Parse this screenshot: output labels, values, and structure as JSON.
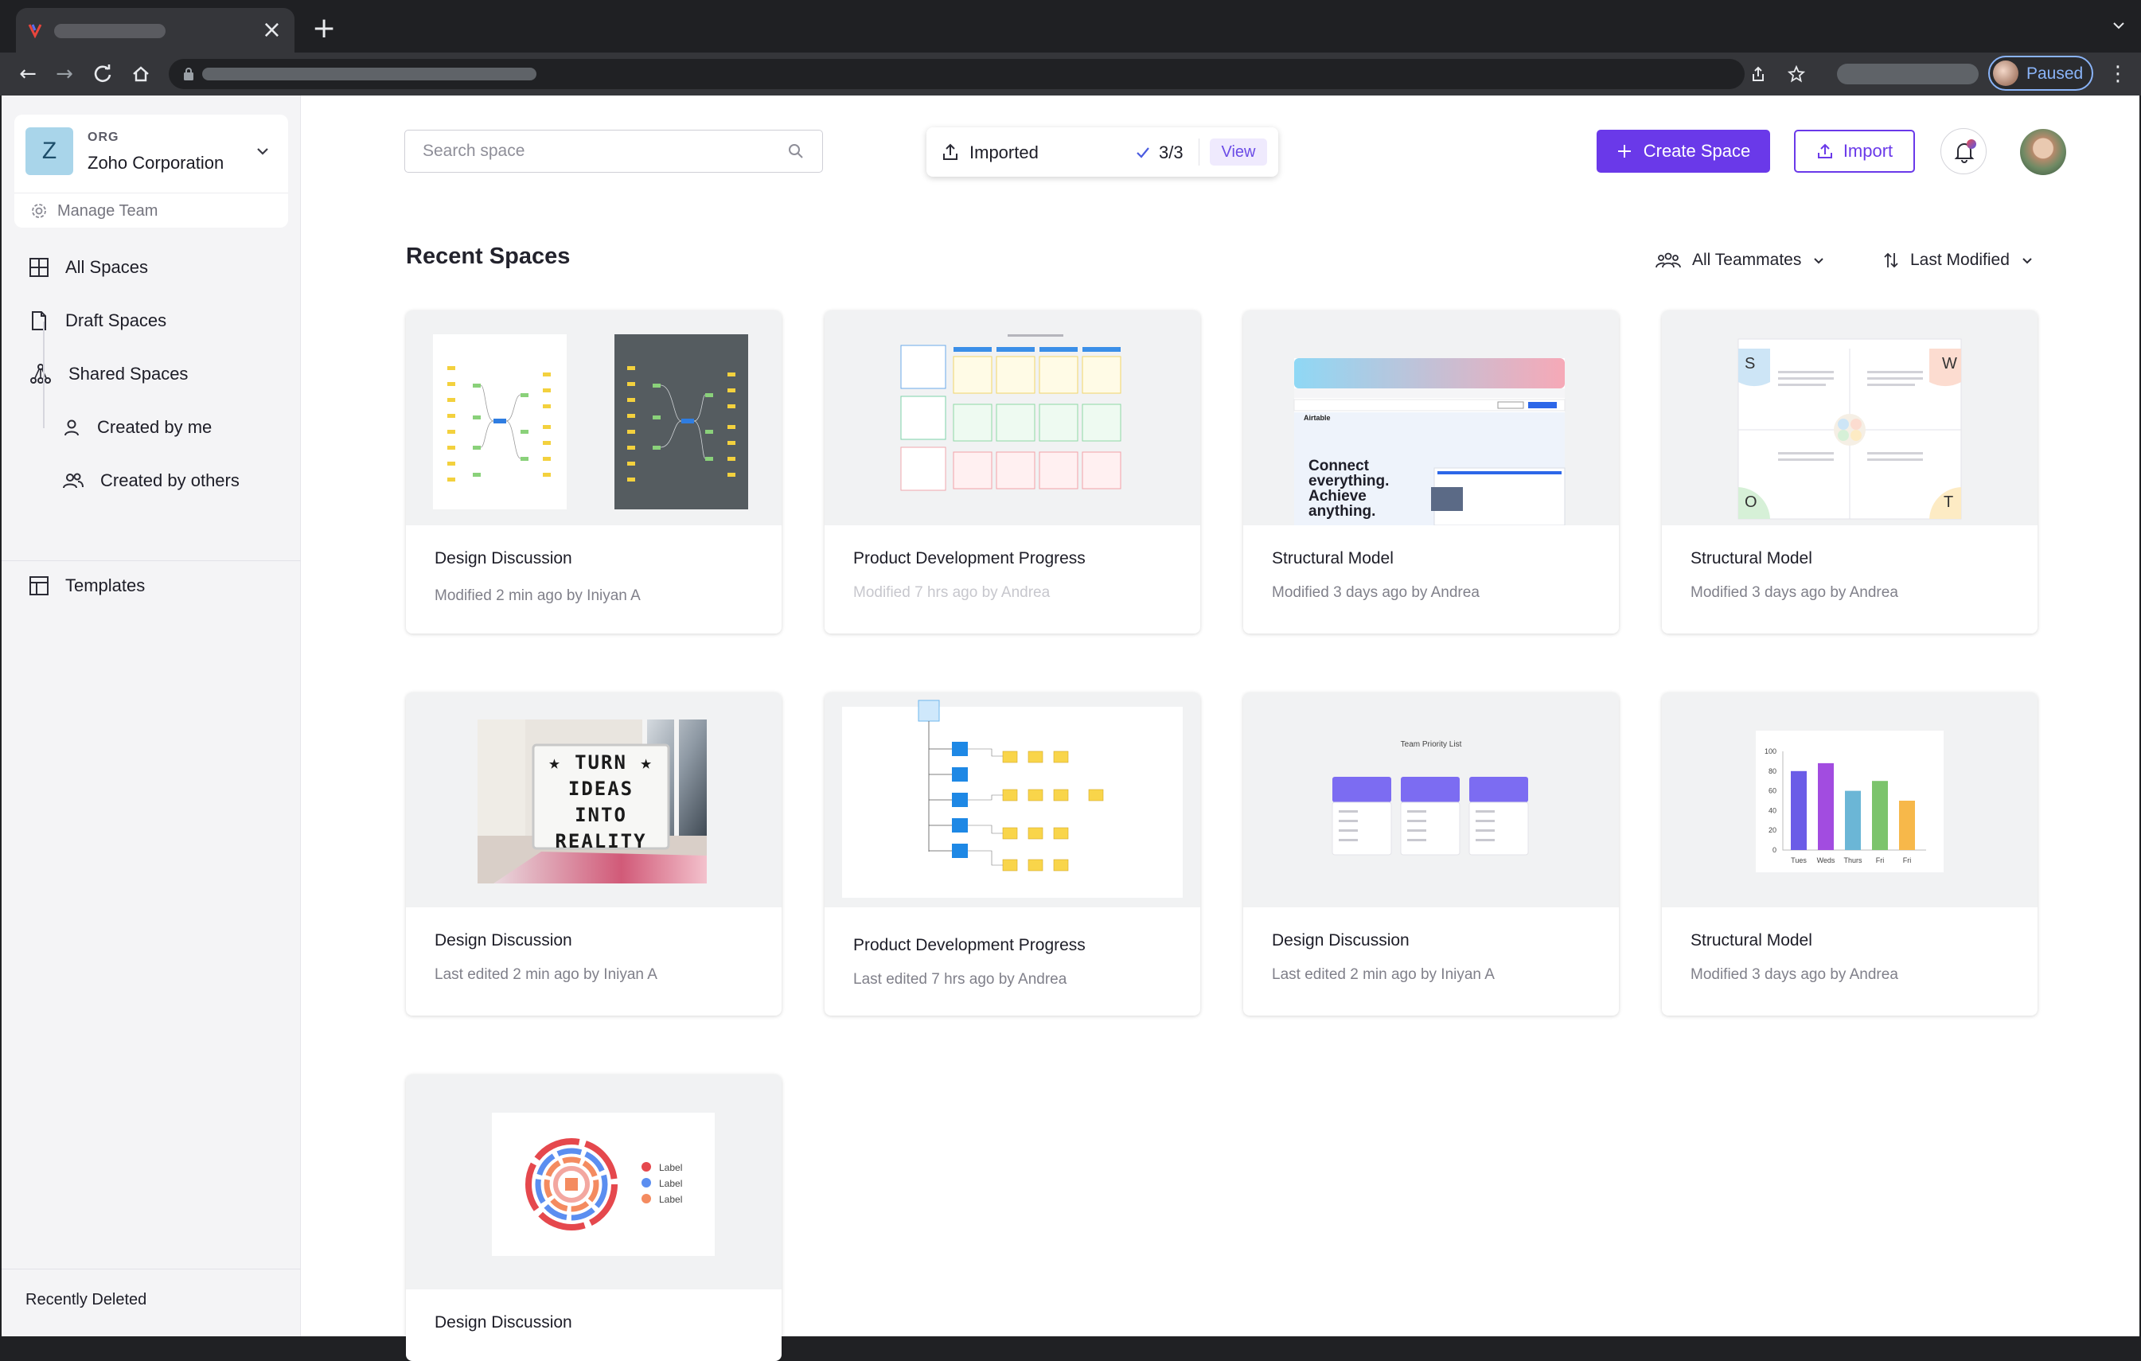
{
  "browser": {
    "profile_status": "Paused"
  },
  "sidebar": {
    "org_kicker": "ORG",
    "org_initial": "Z",
    "org_name": "Zoho Corporation",
    "manage_team": "Manage Team",
    "nav": [
      {
        "label": "All Spaces",
        "icon": "grid-icon"
      },
      {
        "label": "Draft Spaces",
        "icon": "document-icon"
      },
      {
        "label": "Shared Spaces",
        "icon": "shared-network-icon"
      },
      {
        "label": "Created by me",
        "icon": "user-icon"
      },
      {
        "label": "Created by others",
        "icon": "users-icon"
      },
      {
        "label": "Templates",
        "icon": "template-icon"
      }
    ],
    "recently_deleted": "Recently Deleted"
  },
  "header": {
    "search_placeholder": "Search space",
    "import_status": {
      "label": "Imported",
      "count": "3/3",
      "view": "View"
    },
    "create_space": "Create Space",
    "import": "Import"
  },
  "main": {
    "section_title": "Recent Spaces",
    "filter_teammates": "All Teammates",
    "filter_sort": "Last Modified",
    "cards": [
      {
        "title": "Design Discussion",
        "meta": "Modified 2 min ago by Iniyan A",
        "thumb": "mindmap"
      },
      {
        "title": "Product Development Progress",
        "meta": "Modified 7 hrs ago by Andrea",
        "thumb": "kanban"
      },
      {
        "title": "Structural Model",
        "meta": "Modified 3 days ago by Andrea",
        "thumb": "webpage"
      },
      {
        "title": "Structural Model",
        "meta": "Modified 3 days ago by Andrea",
        "thumb": "swot"
      },
      {
        "title": "Design Discussion",
        "meta": "Last edited 2 min ago by Iniyan A",
        "thumb": "photo"
      },
      {
        "title": "Product Development Progress",
        "meta": "Last edited 7 hrs ago by Andrea",
        "thumb": "tree"
      },
      {
        "title": "Design Discussion",
        "meta": "Last edited 2 min ago by Iniyan A",
        "thumb": "priority"
      },
      {
        "title": "Structural Model",
        "meta": "Modified 3 days ago by Andrea",
        "thumb": "barchart"
      },
      {
        "title": "Design Discussion",
        "meta": "",
        "thumb": "radial"
      }
    ],
    "thumb_text": {
      "webpage_heading": "Connect everything. Achieve anything.",
      "webpage_brand": "Airtable",
      "photo_lightbox": "★ TURN ★ IDEAS INTO REALITY",
      "swot_letters": [
        "S",
        "W",
        "O",
        "T"
      ],
      "priority_title": "Team Priority List",
      "chart_y_ticks": [
        "100",
        "80",
        "60",
        "40",
        "20",
        "0"
      ],
      "chart_x_ticks": [
        "Tues",
        "Weds",
        "Thurs",
        "Fri",
        "Fri"
      ],
      "chart_values": [
        80,
        88,
        60,
        70,
        50
      ],
      "radial_labels": [
        "Label",
        "Label",
        "Label"
      ]
    }
  }
}
